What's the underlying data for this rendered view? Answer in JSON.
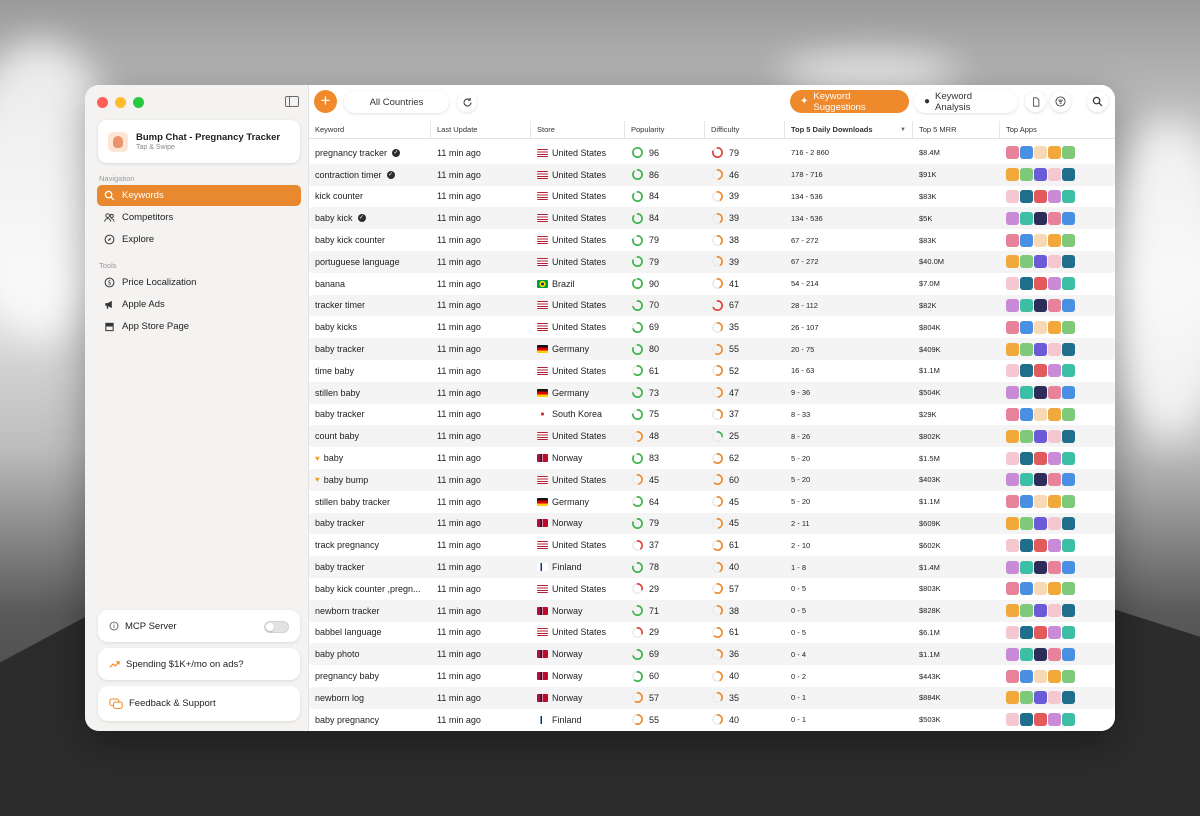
{
  "sidebar": {
    "app": {
      "name": "Bump Chat - Pregnancy Tracker",
      "subtitle": "Tap & Swipe"
    },
    "navigation_label": "Navigation",
    "navigation": [
      {
        "label": "Keywords",
        "icon": "search-icon",
        "active": true
      },
      {
        "label": "Competitors",
        "icon": "people-icon",
        "active": false
      },
      {
        "label": "Explore",
        "icon": "compass-icon",
        "active": false
      }
    ],
    "tools_label": "Tools",
    "tools": [
      {
        "label": "Price Localization",
        "icon": "dollar-circle-icon"
      },
      {
        "label": "Apple Ads",
        "icon": "megaphone-icon"
      },
      {
        "label": "App Store Page",
        "icon": "storefront-icon"
      }
    ],
    "mcp_label": "MCP Server",
    "mcp_enabled": false,
    "promo_label": "Spending $1K+/mo on ads?",
    "feedback_label": "Feedback & Support"
  },
  "toolbar": {
    "country_filter": "All Countries",
    "keyword_suggestions": "Keyword Suggestions",
    "keyword_analysis": "Keyword Analysis"
  },
  "table": {
    "columns": [
      "Keyword",
      "Last Update",
      "Store",
      "Popularity",
      "Difficulty",
      "Top 5 Daily Downloads",
      "Top 5 MRR",
      "Top Apps"
    ],
    "rows": [
      {
        "keyword": "pregnancy tracker",
        "verified": true,
        "favorite": false,
        "updated": "11 min ago",
        "store": "United States",
        "flag": "us",
        "popularity": 96,
        "difficulty": 79,
        "downloads": "716 - 2 860",
        "mrr": "$8.4M"
      },
      {
        "keyword": "contraction timer",
        "verified": true,
        "favorite": false,
        "updated": "11 min ago",
        "store": "United States",
        "flag": "us",
        "popularity": 86,
        "difficulty": 46,
        "downloads": "178 - 716",
        "mrr": "$91K"
      },
      {
        "keyword": "kick counter",
        "verified": false,
        "favorite": false,
        "updated": "11 min ago",
        "store": "United States",
        "flag": "us",
        "popularity": 84,
        "difficulty": 39,
        "downloads": "134 - 536",
        "mrr": "$83K"
      },
      {
        "keyword": "baby kick",
        "verified": true,
        "favorite": false,
        "updated": "11 min ago",
        "store": "United States",
        "flag": "us",
        "popularity": 84,
        "difficulty": 39,
        "downloads": "134 - 536",
        "mrr": "$5K"
      },
      {
        "keyword": "baby kick counter",
        "verified": false,
        "favorite": false,
        "updated": "11 min ago",
        "store": "United States",
        "flag": "us",
        "popularity": 79,
        "difficulty": 38,
        "downloads": "67 - 272",
        "mrr": "$83K"
      },
      {
        "keyword": "portuguese language",
        "verified": false,
        "favorite": false,
        "updated": "11 min ago",
        "store": "United States",
        "flag": "us",
        "popularity": 79,
        "difficulty": 39,
        "downloads": "67 - 272",
        "mrr": "$40.0M"
      },
      {
        "keyword": "banana",
        "verified": false,
        "favorite": false,
        "updated": "11 min ago",
        "store": "Brazil",
        "flag": "br",
        "popularity": 90,
        "difficulty": 41,
        "downloads": "54 - 214",
        "mrr": "$7.0M"
      },
      {
        "keyword": "tracker timer",
        "verified": false,
        "favorite": false,
        "updated": "11 min ago",
        "store": "United States",
        "flag": "us",
        "popularity": 70,
        "difficulty": 67,
        "downloads": "28 - 112",
        "mrr": "$82K"
      },
      {
        "keyword": "baby kicks",
        "verified": false,
        "favorite": false,
        "updated": "11 min ago",
        "store": "United States",
        "flag": "us",
        "popularity": 69,
        "difficulty": 35,
        "downloads": "26 - 107",
        "mrr": "$804K"
      },
      {
        "keyword": "baby tracker",
        "verified": false,
        "favorite": false,
        "updated": "11 min ago",
        "store": "Germany",
        "flag": "de",
        "popularity": 80,
        "difficulty": 55,
        "downloads": "20 - 75",
        "mrr": "$409K"
      },
      {
        "keyword": "time baby",
        "verified": false,
        "favorite": false,
        "updated": "11 min ago",
        "store": "United States",
        "flag": "us",
        "popularity": 61,
        "difficulty": 52,
        "downloads": "16 - 63",
        "mrr": "$1.1M"
      },
      {
        "keyword": "stillen baby",
        "verified": false,
        "favorite": false,
        "updated": "11 min ago",
        "store": "Germany",
        "flag": "de",
        "popularity": 73,
        "difficulty": 47,
        "downloads": "9 - 36",
        "mrr": "$504K"
      },
      {
        "keyword": "baby tracker",
        "verified": false,
        "favorite": false,
        "updated": "11 min ago",
        "store": "South Korea",
        "flag": "kr",
        "popularity": 75,
        "difficulty": 37,
        "downloads": "8 - 33",
        "mrr": "$29K"
      },
      {
        "keyword": "count baby",
        "verified": false,
        "favorite": false,
        "updated": "11 min ago",
        "store": "United States",
        "flag": "us",
        "popularity": 48,
        "difficulty": 25,
        "downloads": "8 - 26",
        "mrr": "$802K"
      },
      {
        "keyword": "baby",
        "verified": false,
        "favorite": true,
        "updated": "11 min ago",
        "store": "Norway",
        "flag": "no",
        "popularity": 83,
        "difficulty": 62,
        "downloads": "5 - 20",
        "mrr": "$1.5M"
      },
      {
        "keyword": "baby bump",
        "verified": false,
        "favorite": true,
        "updated": "11 min ago",
        "store": "United States",
        "flag": "us",
        "popularity": 45,
        "difficulty": 60,
        "downloads": "5 - 20",
        "mrr": "$403K"
      },
      {
        "keyword": "stillen baby tracker",
        "verified": false,
        "favorite": false,
        "updated": "11 min ago",
        "store": "Germany",
        "flag": "de",
        "popularity": 64,
        "difficulty": 45,
        "downloads": "5 - 20",
        "mrr": "$1.1M"
      },
      {
        "keyword": "baby tracker",
        "verified": false,
        "favorite": false,
        "updated": "11 min ago",
        "store": "Norway",
        "flag": "no",
        "popularity": 79,
        "difficulty": 45,
        "downloads": "2 - 11",
        "mrr": "$609K"
      },
      {
        "keyword": "track pregnancy",
        "verified": false,
        "favorite": false,
        "updated": "11 min ago",
        "store": "United States",
        "flag": "us",
        "popularity": 37,
        "difficulty": 61,
        "downloads": "2 - 10",
        "mrr": "$602K"
      },
      {
        "keyword": "baby tracker",
        "verified": false,
        "favorite": false,
        "updated": "11 min ago",
        "store": "Finland",
        "flag": "fi",
        "popularity": 78,
        "difficulty": 40,
        "downloads": "1 - 8",
        "mrr": "$1.4M"
      },
      {
        "keyword": "baby kick counter ,pregn...",
        "verified": false,
        "favorite": false,
        "updated": "11 min ago",
        "store": "United States",
        "flag": "us",
        "popularity": 29,
        "difficulty": 57,
        "downloads": "0 - 5",
        "mrr": "$803K"
      },
      {
        "keyword": "newborn tracker",
        "verified": false,
        "favorite": false,
        "updated": "11 min ago",
        "store": "Norway",
        "flag": "no",
        "popularity": 71,
        "difficulty": 38,
        "downloads": "0 - 5",
        "mrr": "$828K"
      },
      {
        "keyword": "babbel language",
        "verified": false,
        "favorite": false,
        "updated": "11 min ago",
        "store": "United States",
        "flag": "us",
        "popularity": 29,
        "difficulty": 61,
        "downloads": "0 - 5",
        "mrr": "$6.1M"
      },
      {
        "keyword": "baby photo",
        "verified": false,
        "favorite": false,
        "updated": "11 min ago",
        "store": "Norway",
        "flag": "no",
        "popularity": 69,
        "difficulty": 36,
        "downloads": "0 - 4",
        "mrr": "$1.1M"
      },
      {
        "keyword": "pregnancy baby",
        "verified": false,
        "favorite": false,
        "updated": "11 min ago",
        "store": "Norway",
        "flag": "no",
        "popularity": 60,
        "difficulty": 40,
        "downloads": "0 - 2",
        "mrr": "$443K"
      },
      {
        "keyword": "newborn log",
        "verified": false,
        "favorite": false,
        "updated": "11 min ago",
        "store": "Norway",
        "flag": "no",
        "popularity": 57,
        "difficulty": 35,
        "downloads": "0 - 1",
        "mrr": "$884K"
      },
      {
        "keyword": "baby pregnancy",
        "verified": false,
        "favorite": false,
        "updated": "11 min ago",
        "store": "Finland",
        "flag": "fi",
        "popularity": 55,
        "difficulty": 40,
        "downloads": "0 - 1",
        "mrr": "$503K"
      }
    ]
  },
  "colors": {
    "accent": "#ef8a2c",
    "ring_green": "#3cb44b",
    "ring_orange": "#f08a2c",
    "ring_red": "#e0433a",
    "app_icon_palette": [
      "#e8829a",
      "#6b5bd6",
      "#3cbfa4",
      "#f2a93b",
      "#e35a5a",
      "#4a90e2",
      "#f4c7d1",
      "#2d2d5a",
      "#7ec97a",
      "#c98ad8",
      "#f7d9b5",
      "#1f6e8c"
    ]
  }
}
